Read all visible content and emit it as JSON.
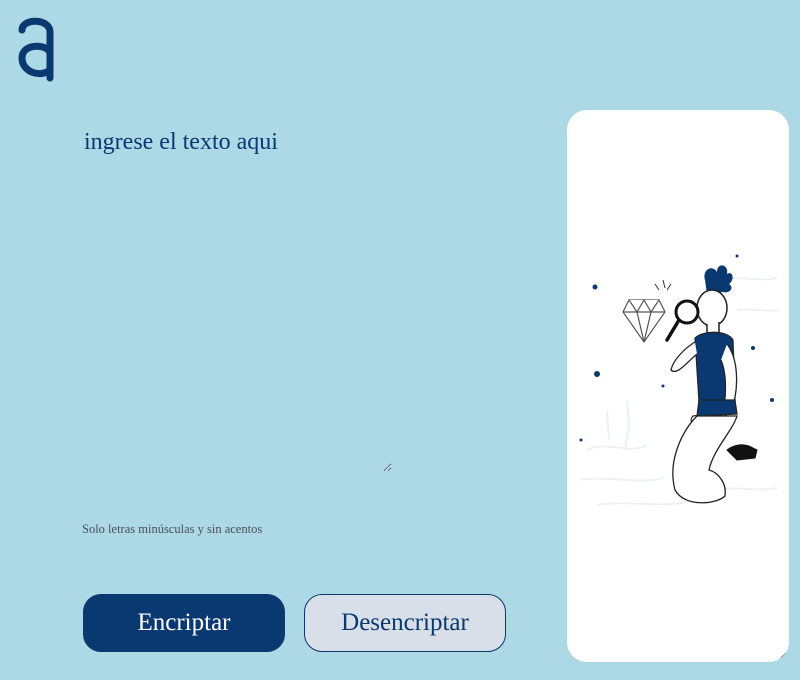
{
  "logo": {
    "icon": "alura-a-logo-icon",
    "color": "#0a3871"
  },
  "encrypt_form": {
    "input_placeholder": "ingrese el texto aqui",
    "input_value": "",
    "hint_text": "Solo letras minúsculas y sin acentos",
    "encrypt_label": "Encriptar",
    "decrypt_label": "Desencriptar"
  },
  "output_panel": {
    "illustration": "person-with-magnifying-glass-and-diamond-illustration",
    "background": "#ffffff"
  },
  "colors": {
    "page_background": "#add8e6",
    "primary": "#0a3871",
    "secondary_button": "#d8dfe8"
  }
}
